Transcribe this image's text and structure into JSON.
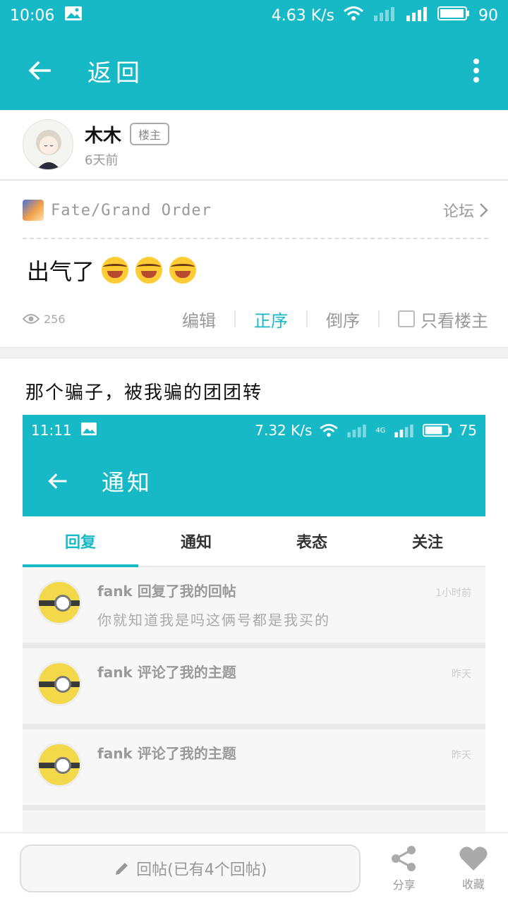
{
  "status_bar": {
    "time": "10:06",
    "speed": "4.63 K/s",
    "battery": "90"
  },
  "app_bar": {
    "title": "返回"
  },
  "author": {
    "name": "木木",
    "badge": "楼主",
    "time": "6天前"
  },
  "forum": {
    "name": "Fate/Grand Order",
    "link": "论坛"
  },
  "post": {
    "title": "出气了",
    "emoji_count": 3
  },
  "meta": {
    "views": "256",
    "edit": "编辑",
    "order_asc": "正序",
    "order_desc": "倒序",
    "only_op": "只看楼主"
  },
  "reply": {
    "text": "那个骗子，被我骗的团团转"
  },
  "screenshot": {
    "status_bar": {
      "time": "11:11",
      "speed": "7.32 K/s",
      "battery": "75",
      "network": "4G"
    },
    "app_bar": {
      "title": "通知"
    },
    "tabs": [
      {
        "label": "回复",
        "active": true
      },
      {
        "label": "通知",
        "active": false
      },
      {
        "label": "表态",
        "active": false
      },
      {
        "label": "关注",
        "active": false
      }
    ],
    "notifications": [
      {
        "title": "fank 回复了我的回帖",
        "time": "1小时前",
        "text": "你就知道我是吗这俩号都是我买的"
      },
      {
        "title": "fank 评论了我的主题",
        "time": "昨天",
        "text": ""
      },
      {
        "title": "fank 评论了我的主题",
        "time": "昨天",
        "text": ""
      }
    ]
  },
  "bottom_bar": {
    "reply_placeholder": "回帖(已有4个回帖)",
    "share": "分享",
    "favorite": "收藏"
  },
  "colors": {
    "accent": "#17b9c7"
  }
}
